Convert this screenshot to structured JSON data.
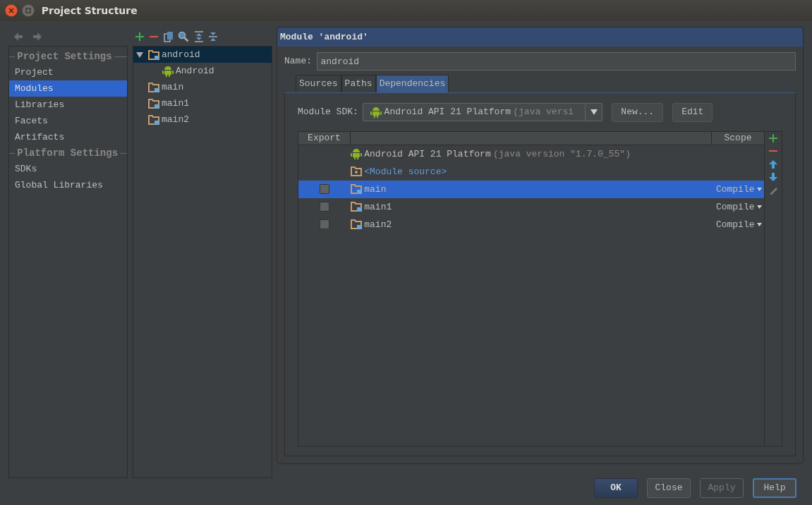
{
  "window": {
    "title": "Project Structure"
  },
  "sidebar": [
    {
      "kind": "header",
      "label": "Project Settings"
    },
    {
      "kind": "item",
      "label": "Project",
      "selected": false
    },
    {
      "kind": "item",
      "label": "Modules",
      "selected": true
    },
    {
      "kind": "item",
      "label": "Libraries",
      "selected": false
    },
    {
      "kind": "item",
      "label": "Facets",
      "selected": false
    },
    {
      "kind": "item",
      "label": "Artifacts",
      "selected": false
    },
    {
      "kind": "header",
      "label": "Platform Settings"
    },
    {
      "kind": "item",
      "label": "SDKs",
      "selected": false
    },
    {
      "kind": "item",
      "label": "Global Libraries",
      "selected": false
    }
  ],
  "tree": [
    {
      "kind": "module",
      "label": "android",
      "selected": true,
      "expanded": true,
      "children": [
        {
          "kind": "facet",
          "label": "Android",
          "selected": false
        }
      ]
    },
    {
      "kind": "module",
      "label": "main",
      "selected": false
    },
    {
      "kind": "module",
      "label": "main1",
      "selected": false
    },
    {
      "kind": "module",
      "label": "main2",
      "selected": false
    }
  ],
  "editor": {
    "title": "Module 'android'",
    "name_label": "Name:",
    "name_value": "android",
    "tabs": [
      {
        "label": "Sources",
        "selected": false
      },
      {
        "label": "Paths",
        "selected": false
      },
      {
        "label": "Dependencies",
        "selected": true
      }
    ],
    "sdk_label": "Module SDK:",
    "sdk_value": "Android API 21 Platform",
    "sdk_detail": "(java versi",
    "sdk_buttons": [
      "New...",
      "Edit"
    ],
    "table": {
      "columns": [
        "Export",
        "Scope"
      ],
      "rows": [
        {
          "kind": "sdk",
          "name": "Android API 21 Platform",
          "detail": "(java version \"1.7.0_55\")",
          "selected": false
        },
        {
          "kind": "source",
          "name": "<Module source>",
          "selected": false
        },
        {
          "kind": "module",
          "name": "main",
          "exported": false,
          "scope": "Compile",
          "selected": true
        },
        {
          "kind": "module",
          "name": "main1",
          "exported": false,
          "scope": "Compile",
          "selected": false
        },
        {
          "kind": "module",
          "name": "main2",
          "exported": false,
          "scope": "Compile",
          "selected": false
        }
      ]
    }
  },
  "buttons": [
    {
      "label": "OK",
      "kind": "default",
      "disabled": false
    },
    {
      "label": "Close",
      "kind": "normal",
      "disabled": false
    },
    {
      "label": "Apply",
      "kind": "normal",
      "disabled": true
    },
    {
      "label": "Help",
      "kind": "focused",
      "disabled": false
    }
  ]
}
